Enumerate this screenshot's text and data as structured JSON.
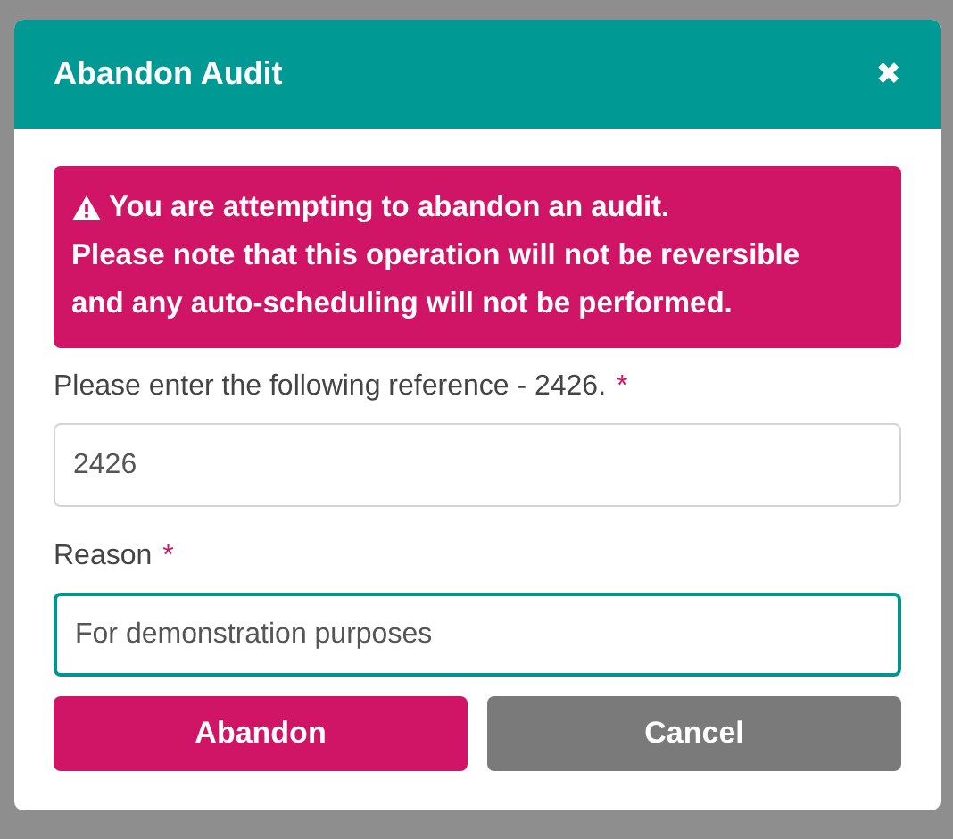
{
  "dialog": {
    "title": "Abandon Audit",
    "close": "✖"
  },
  "alert": {
    "lines": [
      "You are attempting to abandon an audit.",
      "Please note that this operation will not be reversible",
      "and any auto-scheduling will not be performed."
    ]
  },
  "fields": [
    {
      "label": "Please enter the following reference - 2426.",
      "required_mark": "*",
      "value": "2426",
      "focused": false
    },
    {
      "label": "Reason",
      "required_mark": "*",
      "value": "For demonstration purposes",
      "focused": true
    }
  ],
  "buttons": [
    {
      "label": "Abandon",
      "kind": "primary"
    },
    {
      "label": "Cancel",
      "kind": "secondary"
    }
  ]
}
